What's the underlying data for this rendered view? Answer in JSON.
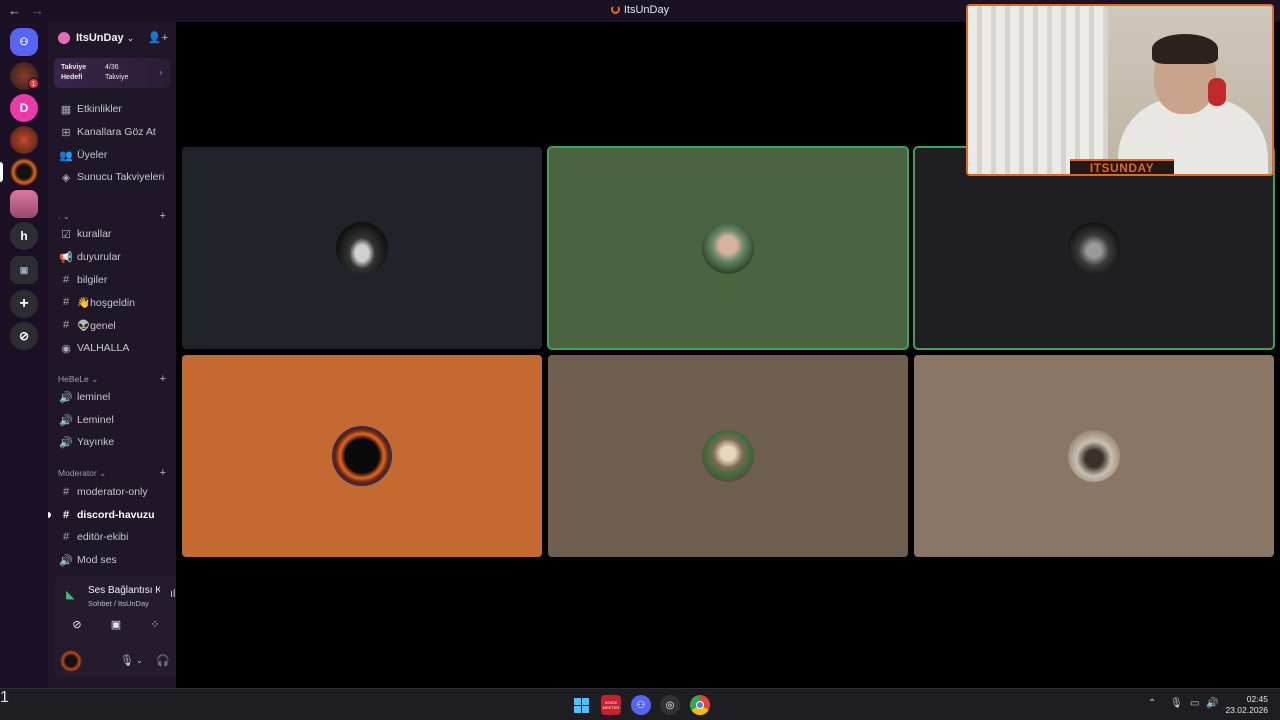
{
  "titlebar": {
    "back": "←",
    "forward": "→",
    "title": "ItsUnDay"
  },
  "rail": {
    "badge_count": "1"
  },
  "guild": {
    "name": "ItsUnDay",
    "boost": {
      "label": "Takviye Hedefi",
      "count": "4/36",
      "count_label": "Takviye"
    }
  },
  "menu": [
    {
      "icon": "calendar-icon",
      "glyph": "▦",
      "label": "Etkinlikler"
    },
    {
      "icon": "browse-icon",
      "glyph": "⊞",
      "label": "Kanallara Göz At"
    },
    {
      "icon": "members-icon",
      "glyph": "👥",
      "label": "Üyeler"
    },
    {
      "icon": "boost-icon",
      "glyph": "◈",
      "label": "Sunucu Takviyeleri"
    }
  ],
  "categories": [
    {
      "name": ".",
      "channels": [
        {
          "glyph": "☑",
          "icon": "rules-icon",
          "label": "kurallar"
        },
        {
          "glyph": "📢",
          "icon": "announcement-icon",
          "label": "duyurular"
        },
        {
          "glyph": "#",
          "icon": "hash-icon",
          "label": "bilgiler"
        },
        {
          "glyph": "#",
          "icon": "hash-icon",
          "label": "👋hoşgeldin"
        },
        {
          "glyph": "#",
          "icon": "hash-icon",
          "label": "👽genel"
        },
        {
          "glyph": "◉",
          "icon": "stage-icon",
          "label": "VALHALLA"
        }
      ]
    },
    {
      "name": "HeBeLe",
      "channels": [
        {
          "glyph": "🔊",
          "icon": "voice-icon",
          "label": "leminel"
        },
        {
          "glyph": "🔊",
          "icon": "voice-icon",
          "label": "Leminel"
        },
        {
          "glyph": "🔊",
          "icon": "voice-icon",
          "label": "Yayınke"
        }
      ]
    },
    {
      "name": "Moderator",
      "channels": [
        {
          "glyph": "#",
          "icon": "hash-icon",
          "label": "moderator-only"
        },
        {
          "glyph": "#",
          "icon": "hash-icon",
          "label": "discord-havuzu",
          "active": true
        },
        {
          "glyph": "#",
          "icon": "hash-icon",
          "label": "editör-ekibi"
        },
        {
          "glyph": "🔊",
          "icon": "voice-icon",
          "label": "Mod ses"
        }
      ]
    }
  ],
  "voice": {
    "status": "Ses Bağlantısı Kuruldu",
    "channel": "Sohbet / ItsUnDay"
  },
  "tiles": [
    {
      "bg": "#20232a",
      "avatar": "car-avatar",
      "speaking": false
    },
    {
      "bg": "#4a6440",
      "avatar": "woman-avatar",
      "speaking": true
    },
    {
      "bg": "#1f1f21",
      "avatar": "man-hat-avatar",
      "speaking": true
    },
    {
      "bg": "#c46a30",
      "avatar": "fire-ring-avatar",
      "speaking": false
    },
    {
      "bg": "#6f5f51",
      "avatar": "cartoon-avatar",
      "speaking": false
    },
    {
      "bg": "#8a7665",
      "avatar": "sleeping-avatar",
      "speaking": false
    }
  ],
  "webcam": {
    "banner": "ITSUNDAY"
  },
  "taskbar": {
    "voicemeeter_label": "VOICE MEETER",
    "discord_badge": "1",
    "time": "02:45",
    "date": "23.02.2026"
  },
  "colors": {
    "accent": "#e8651f",
    "speaking": "#3ba55d",
    "sidebar": "#1f1628"
  }
}
